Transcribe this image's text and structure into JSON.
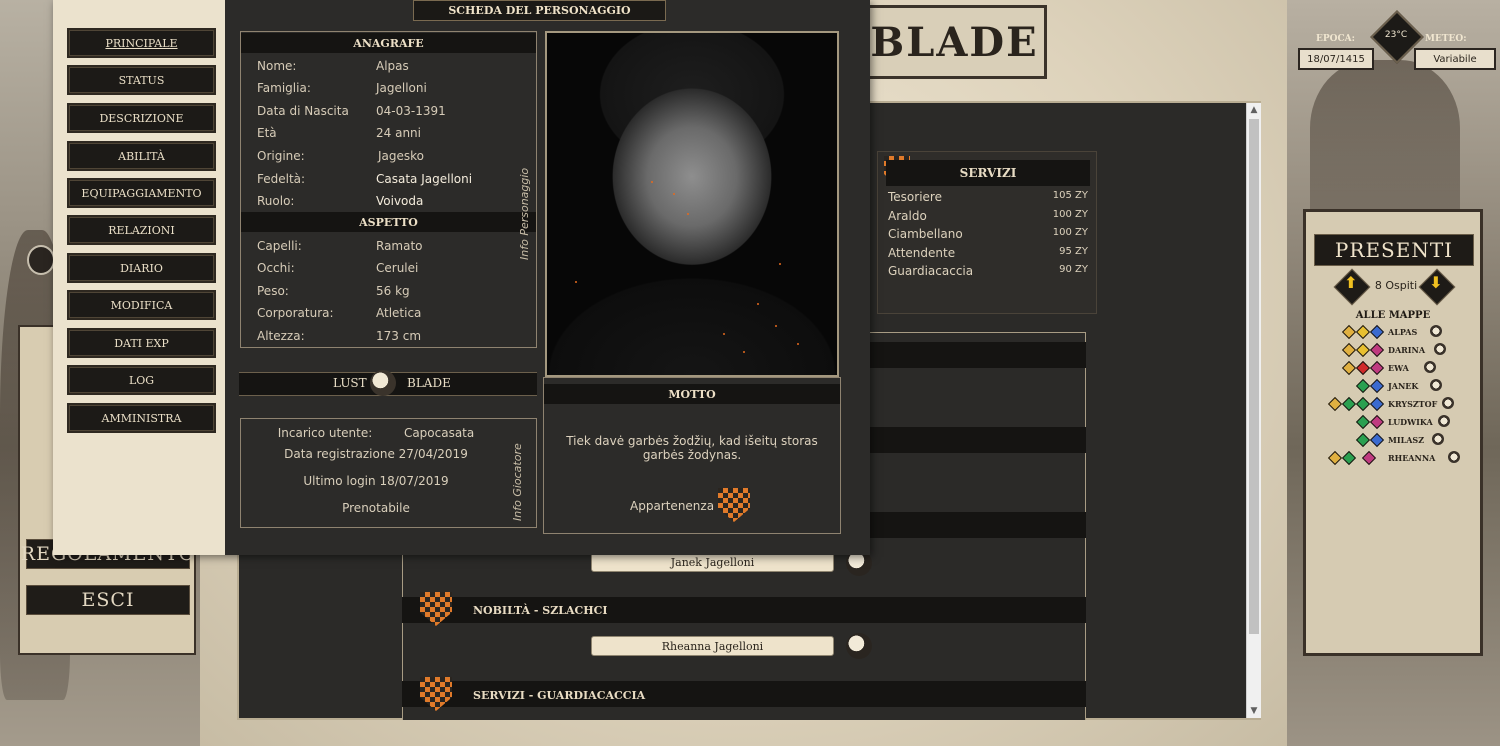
{
  "header": {
    "banner_text": "BLADE"
  },
  "weather": {
    "epoch_label": "EPOCA:",
    "epoch_value": "18/07/1415",
    "temp": "23°C",
    "meteo_label": "METEO:",
    "meteo_value": "Variabile"
  },
  "outer_menu": {
    "items": [
      "REGOLAMENTO",
      "ESCI"
    ]
  },
  "sheet": {
    "title": "SCHEDA DEL PERSONAGGIO",
    "nav": [
      "PRINCIPALE",
      "STATUS",
      "DESCRIZIONE",
      "ABILITÀ",
      "EQUIPAGGIAMENTO",
      "RELAZIONI",
      "DIARIO",
      "MODIFICA",
      "DATI EXP",
      "LOG",
      "AMMINISTRA"
    ],
    "anagrafe_title": "ANAGRAFE",
    "anagrafe": [
      {
        "label": "Nome:",
        "value": "Alpas"
      },
      {
        "label": "Famiglia:",
        "value": "Jagelloni"
      },
      {
        "label": "Data di Nascita",
        "value": "04-03-1391"
      },
      {
        "label": "Età",
        "value": "24 anni"
      },
      {
        "label": "Origine:",
        "value": "Jagesko"
      },
      {
        "label": "Fedeltà:",
        "value": "Casata Jagelloni"
      },
      {
        "label": "Ruolo:",
        "value": "Voivoda"
      }
    ],
    "aspetto_title": "ASPETTO",
    "aspetto": [
      {
        "label": "Capelli:",
        "value": "Ramato"
      },
      {
        "label": "Occhi:",
        "value": "Cerulei"
      },
      {
        "label": "Peso:",
        "value": "56 kg"
      },
      {
        "label": "Corporatura:",
        "value": "Atletica"
      },
      {
        "label": "Altezza:",
        "value": "173 cm"
      }
    ],
    "info_personaggio": "Info Personaggio",
    "blade_left": "LUST",
    "blade_right": "BLADE",
    "player": {
      "incarico_label": "Incarico utente:",
      "incarico_value": "Capocasata",
      "registrazione": "Data registrazione 27/04/2019",
      "ultimo_login": "Ultimo login 18/07/2019",
      "prenotabile": "Prenotabile",
      "info_giocatore": "Info Giocatore"
    },
    "motto_title": "MOTTO",
    "motto_text": "Tiek davė garbės žodžių, kad išeitų storas garbės žodynas.",
    "appartenenza": "Appartenenza"
  },
  "services": {
    "title": "SERVIZI",
    "items": [
      {
        "name": "Tesoriere",
        "cost": "105 ZY"
      },
      {
        "name": "Araldo",
        "cost": "100 ZY"
      },
      {
        "name": "Ciambellano",
        "cost": "100 ZY"
      },
      {
        "name": "Attendente",
        "cost": "95 ZY"
      },
      {
        "name": "Guardiacaccia",
        "cost": "90 ZY"
      }
    ]
  },
  "sections": [
    {
      "pill": "Janek Jagelloni"
    },
    {
      "label": "NOBILTÀ - SZLACHCI",
      "pill": "Rheanna Jagelloni"
    },
    {
      "label": "SERVIZI - GUARDIACACCIA"
    }
  ],
  "presenti": {
    "title": "PRESENTI",
    "ospiti": "8 Ospiti",
    "alle_mappe": "ALLE MAPPE",
    "players": [
      "ALPAS",
      "DARINA",
      "EWA",
      "JANEK",
      "KRYSZTOF",
      "LUDWIKA",
      "MILASZ",
      "RHEANNA"
    ]
  },
  "colors": {
    "accent_orange": "#e07a2a",
    "dark_panel": "#2b2a28",
    "parchment": "#ebe2cd"
  }
}
